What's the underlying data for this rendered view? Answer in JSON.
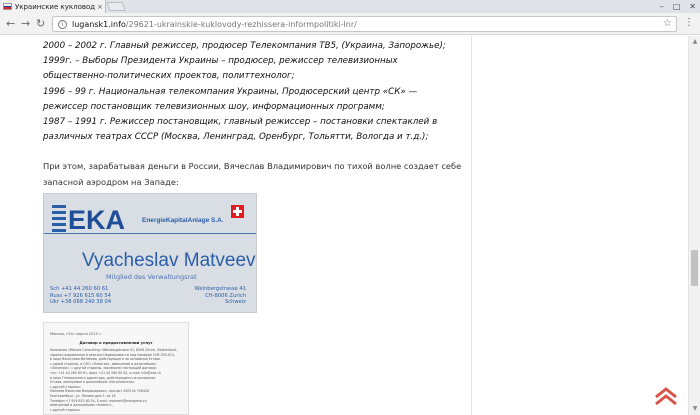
{
  "browser": {
    "tab_title": "Украинские кукловоды",
    "tab_close": "×",
    "url_host": "lugansk1.info",
    "url_path": "/29621-ukrainskie-kuklovody-rezhissera-informpolitiki-lnr/",
    "back_glyph": "←",
    "forward_glyph": "→",
    "reload_glyph": "↻",
    "star_glyph": "☆",
    "menu_glyph": "⋮",
    "minimize_glyph": "–",
    "maximize_glyph": "□",
    "close_glyph": "✕"
  },
  "article": {
    "quote_lines": [
      "2000 – 2002 г. Главный режиссер, продюсер Телекомпания ТВ5, (Украина, Запорожье);",
      "1999г. – Выборы Президента Украины – продюсер, режиссер телевизионных",
      "общественно-политических проектов, политтехнолог;",
      "1996 – 99 г. Национальная телекомпания Украины, Продюсерский центр «СК» —",
      "режиссер постановщик телевизионных шоу, информационных программ;",
      "1987 – 1991 г. Режиссер постановщик, главный режиссер – постановки спектаклей в",
      "различных театрах СССР (Москва, Ленинград, Оренбург, Тольятти, Вологда и т.д.);"
    ],
    "paragraph_lines": [
      "При этом, зарабатывая деньги в России, Вячеслав Владимирович по тихой волне создает себе",
      "запасной аэродром на Западе:"
    ]
  },
  "card": {
    "logo": "EKA",
    "logo_sub": "EnergieKapitalAnlage S.A.",
    "name": "Vyacheslav Matveev",
    "role": "Mitglied des Verwaltungsrat",
    "contacts": [
      "Sch  +41 44 260 60 61",
      "Russ +7 926 615 60 54",
      "Ukr   +38 068 240 38 04"
    ],
    "address": [
      "Weinbergstrasse 41",
      "CH-8006 Zurich",
      "Schweiz"
    ]
  },
  "document": {
    "date": "Москва, «24» марта 2015 г.",
    "title": "Договор о предоставлении услуг",
    "lines": [
      "Компания «Matvee Consulting» Weinbergstrasse 41, 8006 Zürich, Switzerland,",
      "зарегистрированная в реестре Недвижимости под номером CHE-550.013,",
      "в лице Вячеслава Матвеева, действующего на основании Устава,",
      "с одной стороны, и ООО «Энергия», именуемое в дальнейшем",
      "«Заказчик», с другой стороны, заключили настоящий договор:",
      "тел: +41 44 260 60 61, факс +41 44 260 60 62, e-mail: info@eka.ch",
      "в лице Генерального директора, действующего на основании",
      "Устава, именуемое в дальнейшем «Исполнитель».",
      "с другой стороны:",
      "Матвеев Вячеслав Владимирович, паспорт 4503 № 756426",
      "Екатеринбург, ул. Ленина дом 5, кв 16",
      "Телефон +7 926 615 60 54, E-mail: matveev@energieka.ch",
      "именуемый в дальнейшем «Клиент»,",
      "с другой стороны"
    ]
  },
  "scrollbar": {
    "up_glyph": "▲",
    "down_glyph": "▼"
  },
  "colors": {
    "logo_blue": "#1f4d98",
    "card_background": "#d9dee4",
    "swiss_red": "#e01b22",
    "totop_red": "#d9544a"
  }
}
